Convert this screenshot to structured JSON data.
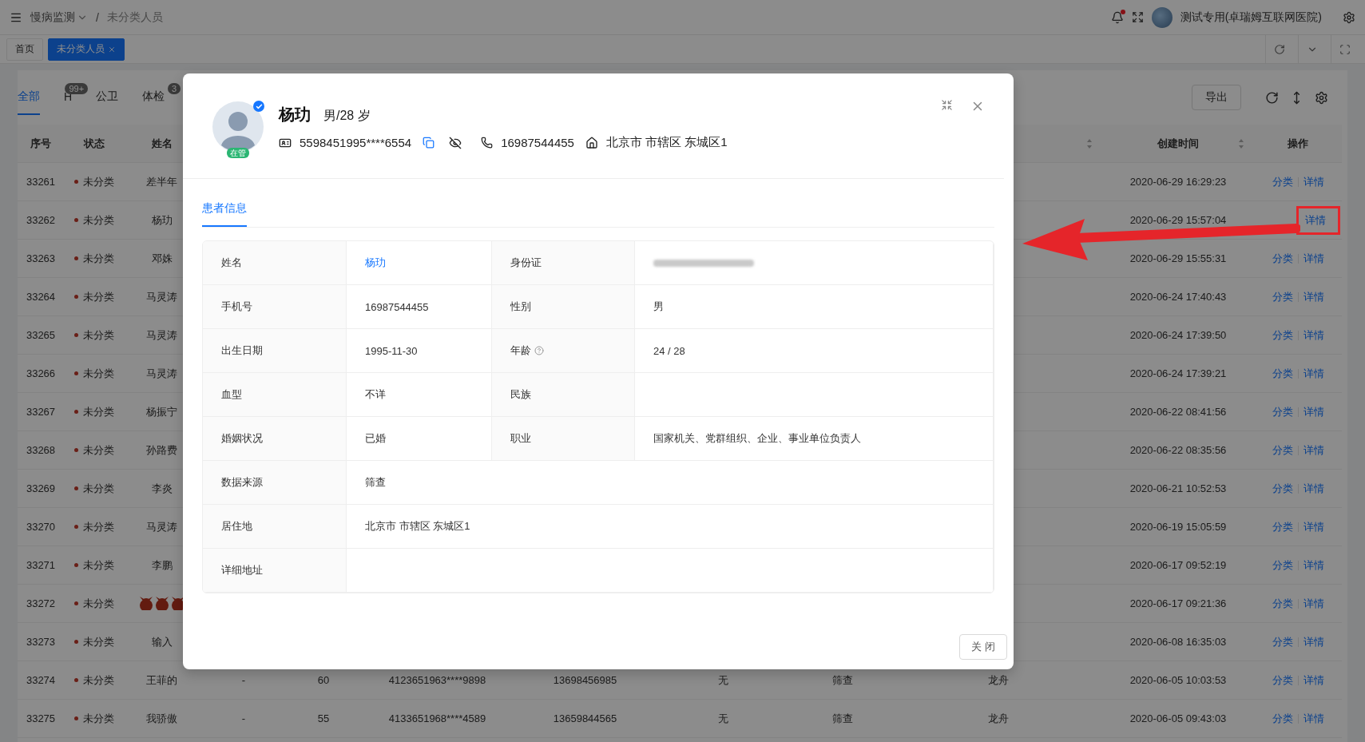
{
  "topbar": {
    "breadcrumb": [
      "慢病监测",
      "/",
      "未分类人员"
    ],
    "notification_dot": true,
    "user": "测试专用(卓瑞姆互联网医院)"
  },
  "page_tabs": [
    {
      "label": "首页",
      "selected": false,
      "closable": false
    },
    {
      "label": "未分类人员",
      "selected": true,
      "closable": true
    }
  ],
  "filter_tabs": [
    {
      "label": "全部",
      "selected": true
    },
    {
      "label": "H",
      "selected": false,
      "badge": "99+"
    },
    {
      "label": "公卫",
      "selected": false
    },
    {
      "label": "体检",
      "selected": false,
      "badge": "3"
    }
  ],
  "export_button": "导出",
  "table": {
    "columns": [
      {
        "label": "序号"
      },
      {
        "label": "状态"
      },
      {
        "label": "姓名"
      },
      {},
      {},
      {},
      {},
      {},
      {},
      {
        "sortable": true
      },
      {
        "label": "创建时间",
        "sortable": true
      },
      {
        "label": "操作"
      }
    ],
    "rows": [
      {
        "kind": "text",
        "annotated": false,
        "cells": [
          "33261",
          "未分类",
          "差半年"
        ],
        "created": "2020-06-29 16:29:23",
        "actions": [
          "分类",
          "详情"
        ]
      },
      {
        "kind": "text",
        "annotated": true,
        "cells": [
          "33262",
          "未分类",
          "杨玏"
        ],
        "created": "2020-06-29 15:57:04",
        "actions": [
          "详情"
        ]
      },
      {
        "kind": "text",
        "annotated": false,
        "cells": [
          "33263",
          "未分类",
          "邓姝"
        ],
        "created": "2020-06-29 15:55:31",
        "actions": [
          "分类",
          "详情"
        ]
      },
      {
        "kind": "text",
        "annotated": false,
        "cells": [
          "33264",
          "未分类",
          "马灵涛"
        ],
        "created": "2020-06-24 17:40:43",
        "actions": [
          "分类",
          "详情"
        ]
      },
      {
        "kind": "text",
        "annotated": false,
        "cells": [
          "33265",
          "未分类",
          "马灵涛"
        ],
        "created": "2020-06-24 17:39:50",
        "actions": [
          "分类",
          "详情"
        ]
      },
      {
        "kind": "text",
        "annotated": false,
        "cells": [
          "33266",
          "未分类",
          "马灵涛"
        ],
        "created": "2020-06-24 17:39:21",
        "actions": [
          "分类",
          "详情"
        ]
      },
      {
        "kind": "text",
        "annotated": false,
        "cells": [
          "33267",
          "未分类",
          "杨振宁"
        ],
        "created": "2020-06-22 08:41:56",
        "actions": [
          "分类",
          "详情"
        ]
      },
      {
        "kind": "text",
        "annotated": false,
        "cells": [
          "33268",
          "未分类",
          "孙路费"
        ],
        "created": "2020-06-22 08:35:56",
        "actions": [
          "分类",
          "详情"
        ]
      },
      {
        "kind": "text",
        "annotated": false,
        "cells": [
          "33269",
          "未分类",
          "李炎"
        ],
        "created": "2020-06-21 10:52:53",
        "actions": [
          "分类",
          "详情"
        ]
      },
      {
        "kind": "text",
        "annotated": false,
        "cells": [
          "33270",
          "未分类",
          "马灵涛"
        ],
        "created": "2020-06-19 15:05:59",
        "actions": [
          "分类",
          "详情"
        ]
      },
      {
        "kind": "text",
        "annotated": false,
        "cells": [
          "33271",
          "未分类",
          "李鹏"
        ],
        "created": "2020-06-17 09:52:19",
        "actions": [
          "分类",
          "详情"
        ]
      },
      {
        "kind": "emoji",
        "annotated": false,
        "cells": [
          "33272",
          "未分类"
        ],
        "created": "2020-06-17 09:21:36",
        "actions": [
          "分类",
          "详情"
        ]
      },
      {
        "kind": "text",
        "annotated": false,
        "cells": [
          "33273",
          "未分类",
          "输入"
        ],
        "created": "2020-06-08 16:35:03",
        "actions": [
          "分类",
          "详情"
        ]
      },
      {
        "kind": "text",
        "annotated": false,
        "cells": [
          "33274",
          "未分类",
          "王菲的",
          "-",
          "60",
          "4123651963****9898",
          "13698456985",
          "无",
          "筛查",
          "龙舟"
        ],
        "created": "2020-06-05 10:03:53",
        "actions": [
          "分类",
          "详情"
        ]
      },
      {
        "kind": "text",
        "annotated": false,
        "cells": [
          "33275",
          "未分类",
          "我骄傲",
          "-",
          "55",
          "4133651968****4589",
          "13659844565",
          "无",
          "筛查",
          "龙舟"
        ],
        "created": "2020-06-05 09:43:03",
        "actions": [
          "分类",
          "详情"
        ]
      }
    ]
  },
  "modal": {
    "avatar_verified": true,
    "avatar_tag": "在管",
    "name": "杨玏",
    "gender_age": "男/28 岁",
    "id_number": "5598451995****6554",
    "phone": "16987544455",
    "address": "北京市 市辖区 东城区1",
    "tabs": [
      {
        "label": "患者信息",
        "selected": true
      }
    ],
    "details": [
      [
        {
          "label": "姓名",
          "value": "杨玏",
          "link": true
        },
        {
          "label": "身份证",
          "blurred": true
        }
      ],
      [
        {
          "label": "手机号",
          "value": "16987544455"
        },
        {
          "label": "性别",
          "value": "男"
        }
      ],
      [
        {
          "label": "出生日期",
          "value": "1995-11-30"
        },
        {
          "label": "年龄",
          "value": "24 / 28",
          "help": true
        }
      ],
      [
        {
          "label": "血型",
          "value": "不详"
        },
        {
          "label": "民族"
        }
      ],
      [
        {
          "label": "婚姻状况",
          "value": "已婚"
        },
        {
          "label": "职业",
          "value": "国家机关、党群组织、企业、事业单位负责人"
        }
      ],
      [
        {
          "label": "数据来源",
          "value": "筛查"
        }
      ],
      [
        {
          "label": "居住地",
          "value": "北京市 市辖区 东城区1"
        }
      ],
      [
        {
          "label": "详细地址"
        }
      ]
    ],
    "close_button": "关 闭"
  }
}
